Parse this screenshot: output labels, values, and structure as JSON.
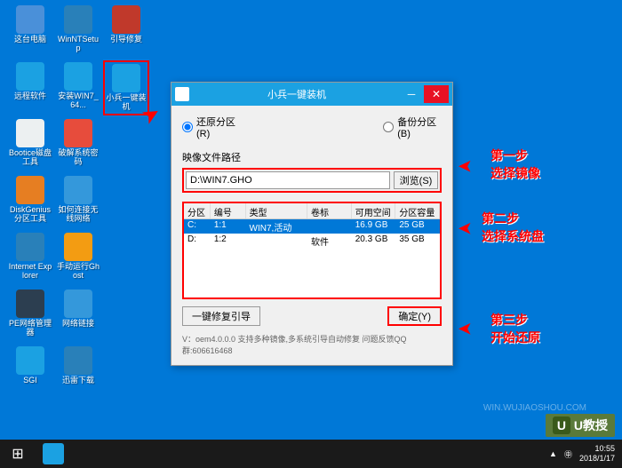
{
  "desktop_icons": [
    {
      "label": "这台电脑",
      "color": "#4a90d9"
    },
    {
      "label": "WinNTSetup",
      "color": "#2980b9"
    },
    {
      "label": "引导修复",
      "color": "#c0392b"
    },
    {
      "label": "远程软件",
      "color": "#1ba1e2"
    },
    {
      "label": "安装WIN7_64...",
      "color": "#1ba1e2"
    },
    {
      "label": "小兵一键装机",
      "color": "#1ba1e2",
      "selected": true
    },
    {
      "label": "Bootice磁盘工具",
      "color": "#ecf0f1"
    },
    {
      "label": "破解系统密码",
      "color": "#e74c3c"
    },
    {
      "label": "",
      "color": ""
    },
    {
      "label": "DiskGenius分区工具",
      "color": "#e67e22"
    },
    {
      "label": "如何连接无线网络",
      "color": "#3498db"
    },
    {
      "label": "",
      "color": ""
    },
    {
      "label": "Internet Explorer",
      "color": "#2980b9"
    },
    {
      "label": "手动运行Ghost",
      "color": "#f39c12"
    },
    {
      "label": "",
      "color": ""
    },
    {
      "label": "PE网络管理器",
      "color": "#2c3e50"
    },
    {
      "label": "网络链接",
      "color": "#3498db"
    },
    {
      "label": "",
      "color": ""
    },
    {
      "label": "SGI",
      "color": "#1ba1e2"
    },
    {
      "label": "迅雷下载",
      "color": "#2980b9"
    }
  ],
  "dialog": {
    "title": "小兵一键装机",
    "radio_restore": "还原分区(R)",
    "radio_backup": "备份分区(B)",
    "image_path_label": "映像文件路径",
    "image_path_value": "D:\\WIN7.GHO",
    "browse_label": "浏览(S)",
    "columns": {
      "part": "分区",
      "num": "编号",
      "type": "类型",
      "vol": "卷标",
      "free": "可用空间",
      "size": "分区容量"
    },
    "rows": [
      {
        "part": "C:",
        "num": "1:1",
        "type": "WIN7,活动",
        "vol": "",
        "free": "16.9 GB",
        "size": "25 GB",
        "selected": true
      },
      {
        "part": "D:",
        "num": "1:2",
        "type": "",
        "vol": "软件",
        "free": "20.3 GB",
        "size": "35 GB",
        "selected": false
      }
    ],
    "repair_boot_label": "一键修复引导",
    "ok_label": "确定(Y)",
    "footer": "V：oem4.0.0.0      支持多种镜像,多系统引导自动修复  问题反馈QQ群:606616468"
  },
  "annotations": {
    "step1_title": "第一步",
    "step1_desc": "选择镜像",
    "step2_title": "第二步",
    "step2_desc": "选择系统盘",
    "step3_title": "第三步",
    "step3_desc": "开始还原"
  },
  "watermark_text": "WIN.WUJIAOSHOU.COM",
  "watermark_brand": "U教授",
  "taskbar": {
    "time": "10:55",
    "date": "2018/1/17"
  }
}
